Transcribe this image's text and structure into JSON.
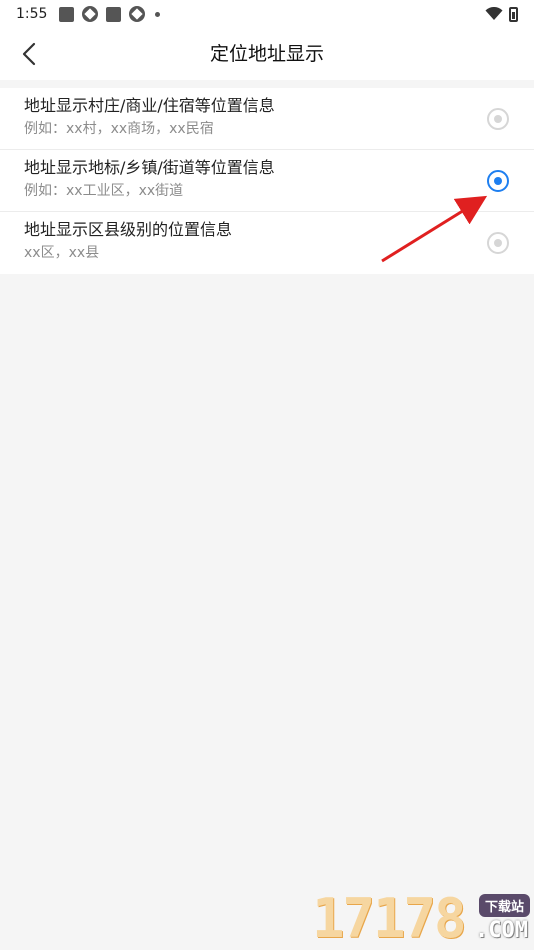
{
  "status_bar": {
    "time": "1:55",
    "icons": [
      "square-notification-icon",
      "aperture-icon",
      "square-notification-icon",
      "aperture-icon",
      "dot-icon"
    ],
    "right_icons": [
      "wifi-icon",
      "battery-icon"
    ]
  },
  "header": {
    "title": "定位地址显示",
    "back_icon": "chevron-left-icon"
  },
  "options": [
    {
      "title": "地址显示村庄/商业/住宿等位置信息",
      "example": "例如：xx村，xx商场，xx民宿",
      "selected": false
    },
    {
      "title": "地址显示地标/乡镇/街道等位置信息",
      "example": "例如：xx工业区，xx街道",
      "selected": true
    },
    {
      "title": "地址显示区县级别的位置信息",
      "example": "xx区，xx县",
      "selected": false
    }
  ],
  "annotation": {
    "arrow_color": "#e02020"
  },
  "watermark": {
    "number": "17178",
    "badge": "下载站",
    "suffix": ".COM"
  },
  "colors": {
    "accent": "#1e7ff0",
    "radio_unchecked": "#d6d6d6",
    "background": "#f5f5f5"
  }
}
